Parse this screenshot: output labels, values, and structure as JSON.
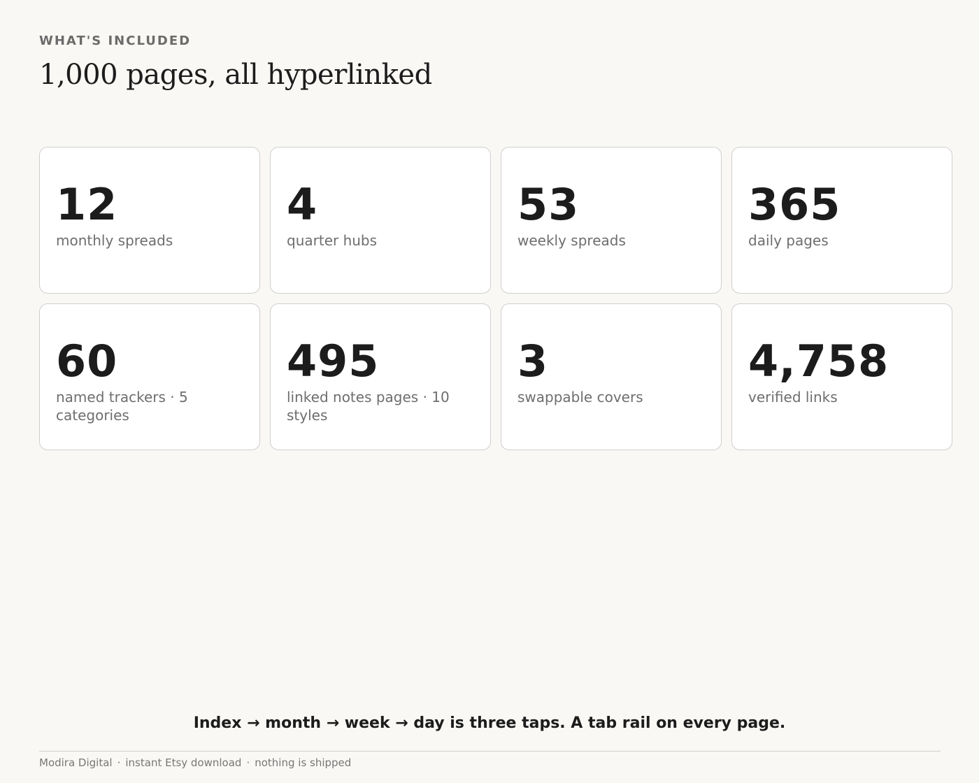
{
  "header": {
    "eyebrow": "WHAT'S INCLUDED",
    "title": "1,000 pages, all hyperlinked"
  },
  "stats": [
    {
      "value": "12",
      "label": "monthly spreads"
    },
    {
      "value": "4",
      "label": "quarter hubs"
    },
    {
      "value": "53",
      "label": "weekly spreads"
    },
    {
      "value": "365",
      "label": "daily pages"
    },
    {
      "value": "60",
      "label": "named trackers · 5 categories"
    },
    {
      "value": "495",
      "label": "linked notes pages · 10 styles"
    },
    {
      "value": "3",
      "label": "swappable covers"
    },
    {
      "value": "4,758",
      "label": "verified links"
    }
  ],
  "tagline": "Index → month → week → day is three taps. A tab rail on every page.",
  "footer": {
    "items": [
      "Modira Digital",
      "instant Etsy download",
      "nothing is shipped"
    ],
    "separator": "·"
  },
  "colors": {
    "background": "#f9f8f5",
    "card": "#ffffff",
    "text": "#1c1c1c",
    "muted": "#6e6e6e"
  }
}
